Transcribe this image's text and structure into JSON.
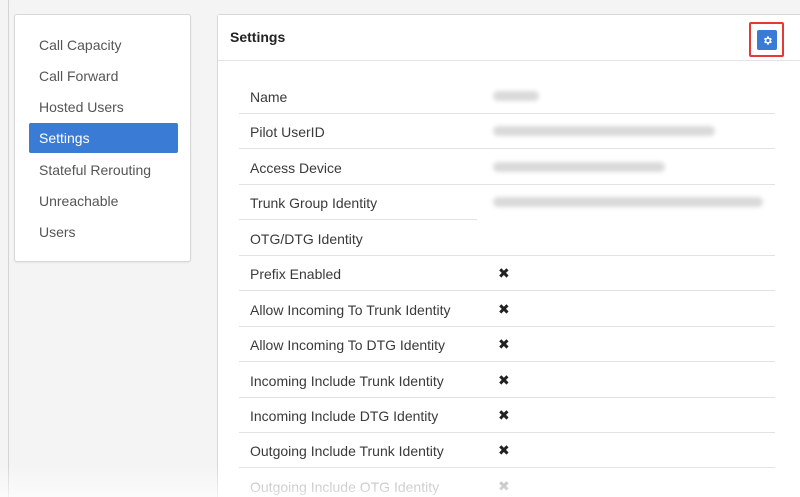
{
  "sidebar": {
    "items": [
      {
        "label": "Call Capacity",
        "active": false
      },
      {
        "label": "Call Forward",
        "active": false
      },
      {
        "label": "Hosted Users",
        "active": false
      },
      {
        "label": "Settings",
        "active": true
      },
      {
        "label": "Stateful Rerouting",
        "active": false
      },
      {
        "label": "Unreachable",
        "active": false
      },
      {
        "label": "Users",
        "active": false
      }
    ]
  },
  "panel": {
    "title": "Settings",
    "gear_icon": "gear-icon",
    "accent_color": "#3a7bd5",
    "highlight_color": "#e53935"
  },
  "settings": {
    "rows": [
      {
        "label": "Name",
        "value": "blurred"
      },
      {
        "label": "Pilot UserID",
        "value": "blurred"
      },
      {
        "label": "Access Device",
        "value": "blurred"
      },
      {
        "label": "Trunk Group Identity",
        "value": "blurred"
      },
      {
        "label": "OTG/DTG Identity",
        "value": ""
      },
      {
        "label": "Prefix Enabled",
        "value": "✖"
      },
      {
        "label": "Allow Incoming To Trunk Identity",
        "value": "✖"
      },
      {
        "label": "Allow Incoming To DTG Identity",
        "value": "✖"
      },
      {
        "label": "Incoming Include Trunk Identity",
        "value": "✖"
      },
      {
        "label": "Incoming Include DTG Identity",
        "value": "✖"
      },
      {
        "label": "Outgoing Include Trunk Identity",
        "value": "✖"
      },
      {
        "label": "Outgoing Include OTG Identity",
        "value": "✖"
      }
    ]
  }
}
